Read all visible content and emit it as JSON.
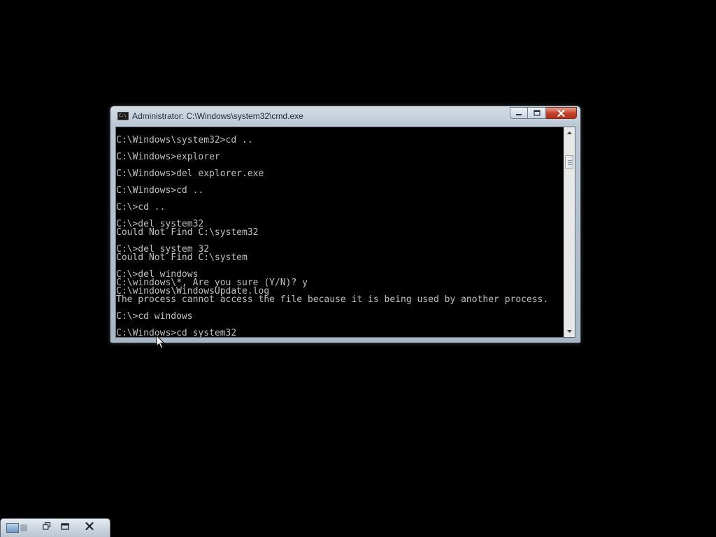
{
  "window": {
    "title": "Administrator: C:\\Windows\\system32\\cmd.exe",
    "app_icon_text": "C:\\",
    "buttons": [
      "minimize",
      "maximize",
      "close"
    ]
  },
  "console": {
    "lines": [
      "C:\\Windows\\system32>cd ..",
      "",
      "C:\\Windows>explorer",
      "",
      "C:\\Windows>del explorer.exe",
      "",
      "C:\\Windows>cd ..",
      "",
      "C:\\>cd ..",
      "",
      "C:\\>del system32",
      "Could Not Find C:\\system32",
      "",
      "C:\\>del system 32",
      "Could Not Find C:\\system",
      "",
      "C:\\>del windows",
      "C:\\windows\\*, Are you sure (Y/N)? y",
      "C:\\windows\\WindowsUpdate.log",
      "The process cannot access the file because it is being used by another process.",
      "",
      "C:\\>cd windows",
      "",
      "C:\\Windows>cd system32"
    ],
    "text_color": "#c0c0c0",
    "background_color": "#000000"
  },
  "scrollbar": {
    "up_icon": "scroll-up-arrow-icon",
    "down_icon": "scroll-down-arrow-icon"
  },
  "minimized_window": {
    "icon": "minimized-app-icon",
    "buttons": [
      "restore",
      "maximize",
      "close"
    ]
  },
  "colors": {
    "desktop": "#000000",
    "close_button": "#c0402a",
    "frame": "#bcc8d4"
  }
}
